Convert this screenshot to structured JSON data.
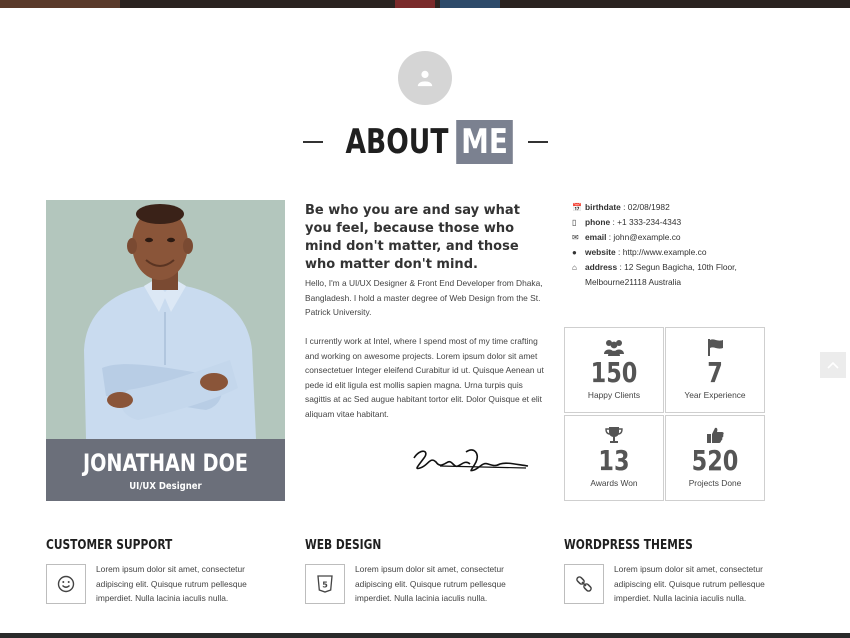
{
  "heading": {
    "about": "ABOUT",
    "me": "ME"
  },
  "profile": {
    "name": "JONATHAN DOE",
    "role": "UI/UX Designer"
  },
  "intro": {
    "quote": "Be who you are and say what you feel, because those who mind don't matter, and those who matter don't mind.",
    "paragraph1": "Hello, I'm a UI/UX Designer & Front End Developer from Dhaka, Bangladesh. I hold a master degree of Web Design from the St. Patrick University.",
    "paragraph2": "I currently work at Intel, where I spend most of my time crafting and working on awesome projects. Lorem ipsum dolor sit amet consectetuer Integer eleifend Curabitur id ut. Quisque Aenean ut pede id elit ligula est mollis sapien magna. Urna turpis quis sagittis at ac Sed augue habitant tortor elit. Dolor Quisque et elit aliquam vitae habitant."
  },
  "contacts": [
    {
      "icon": "calendar-icon",
      "key": "birthdate",
      "value": " : 02/08/1982"
    },
    {
      "icon": "phone-icon",
      "key": "phone",
      "value": " : +1 333-234-4343"
    },
    {
      "icon": "envelope-icon",
      "key": "email",
      "value": " : john@example.co"
    },
    {
      "icon": "globe-icon",
      "key": "website",
      "value": " : http://www.example.co"
    },
    {
      "icon": "home-icon",
      "key": "address",
      "value": " : 12 Segun Bagicha, 10th Floor, Melbourne21118 Australia"
    }
  ],
  "stats": [
    {
      "icon": "users-icon",
      "number": "150",
      "label": "Happy Clients"
    },
    {
      "icon": "flag-icon",
      "number": "7",
      "label": "Year Experience"
    },
    {
      "icon": "trophy-icon",
      "number": "13",
      "label": "Awards Won"
    },
    {
      "icon": "thumbs-up-icon",
      "number": "520",
      "label": "Projects Done"
    }
  ],
  "services": [
    {
      "icon": "smile-icon",
      "title": "CUSTOMER SUPPORT",
      "text": "Lorem ipsum dolor sit amet, consectetur adipiscing elit. Quisque rutrum pellesque imperdiet. Nulla lacinia iaculis nulla."
    },
    {
      "icon": "html5-icon",
      "title": "WEB DESIGN",
      "text": "Lorem ipsum dolor sit amet, consectetur adipiscing elit. Quisque rutrum pellesque imperdiet. Nulla lacinia iaculis nulla."
    },
    {
      "icon": "link-icon",
      "title": "WORDPRESS THEMES",
      "text": "Lorem ipsum dolor sit amet, consectetur adipiscing elit. Quisque rutrum pellesque imperdiet. Nulla lacinia iaculis nulla."
    }
  ],
  "colors": {
    "accent": "#7b8190",
    "name_box": "#6b6f7a",
    "photo_bg": "#b3c6bd"
  }
}
